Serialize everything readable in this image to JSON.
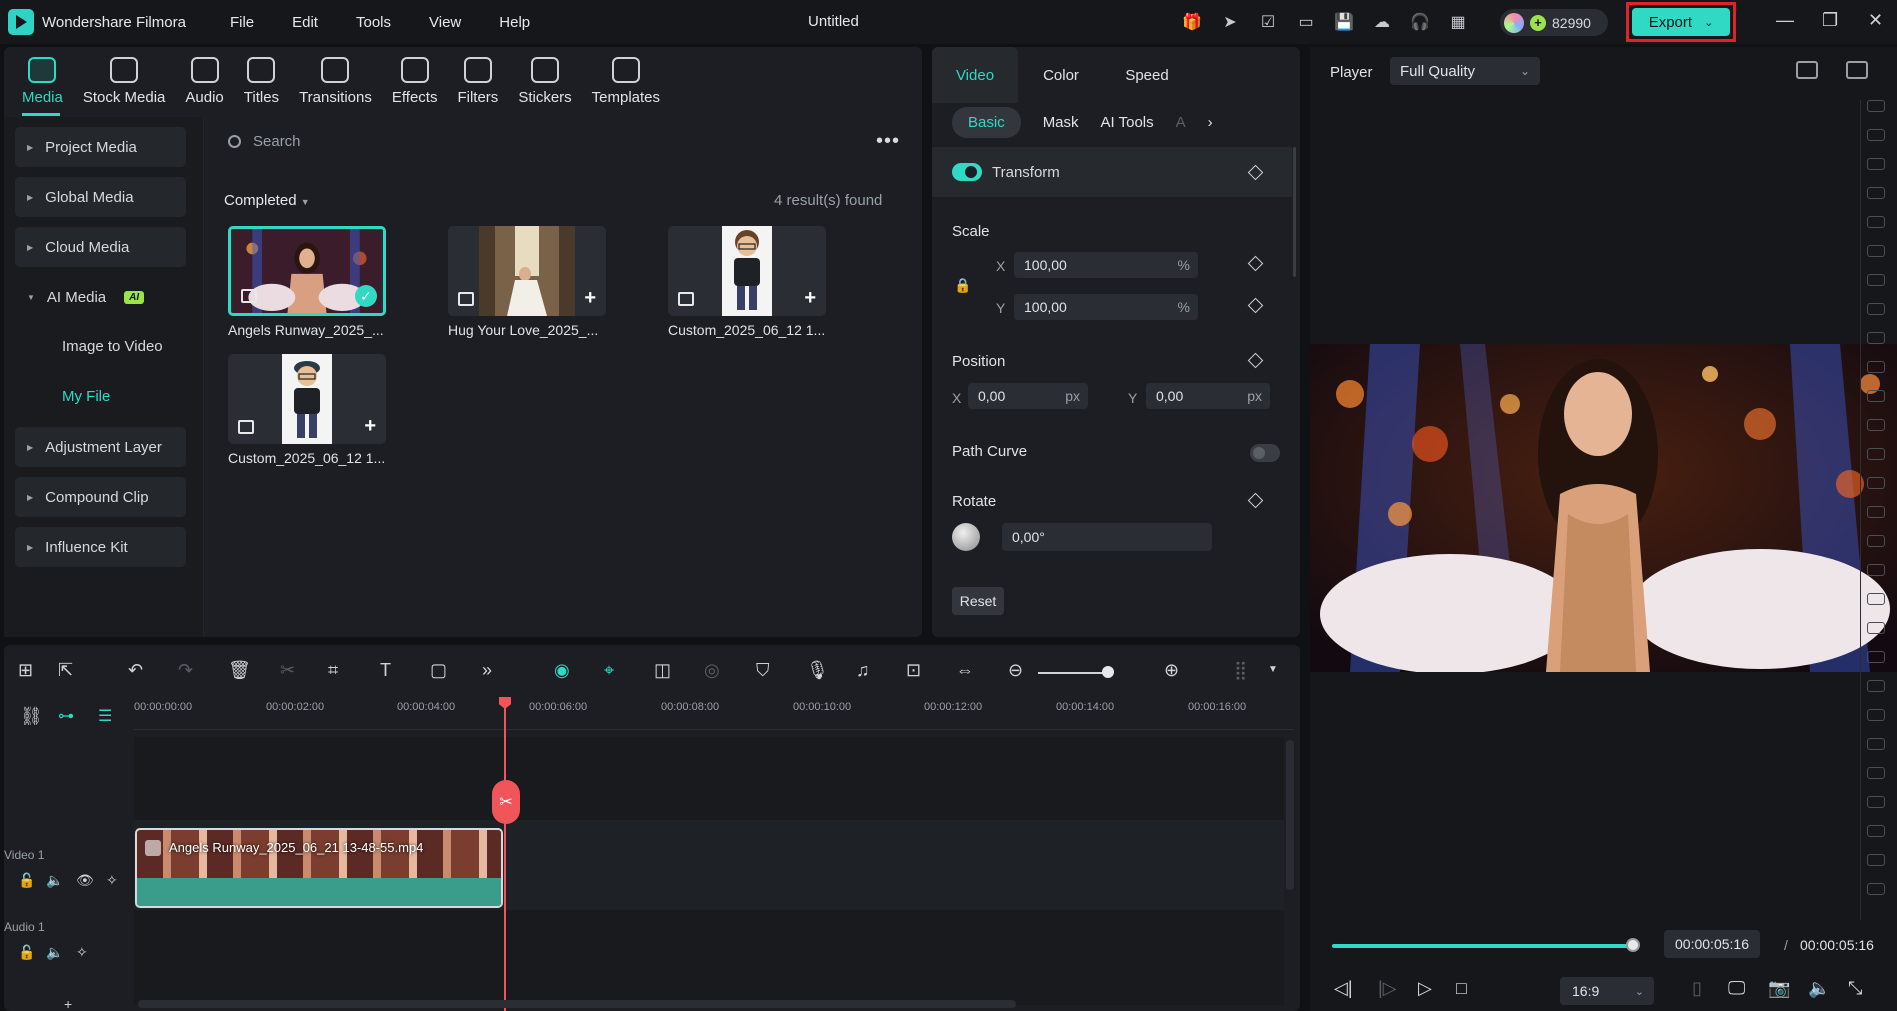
{
  "titlebar": {
    "app_name": "Wondershare Filmora",
    "menu": [
      "File",
      "Edit",
      "Tools",
      "View",
      "Help"
    ],
    "doc_title": "Untitled",
    "credits": "82990",
    "export_label": "Export"
  },
  "media_tabs": [
    "Media",
    "Stock Media",
    "Audio",
    "Titles",
    "Transitions",
    "Effects",
    "Filters",
    "Stickers",
    "Templates"
  ],
  "sidebar": {
    "items": [
      "Project Media",
      "Global Media",
      "Cloud Media",
      "AI Media",
      "Adjustment Layer",
      "Compound Clip",
      "Influence Kit"
    ],
    "ai_badge": "AI",
    "sub_items": [
      "Image to Video",
      "My File"
    ]
  },
  "library": {
    "search_placeholder": "Search",
    "filter_label": "Completed",
    "results": "4 result(s) found",
    "items": [
      {
        "label": "Angels Runway_2025_..."
      },
      {
        "label": "Hug Your Love_2025_..."
      },
      {
        "label": "Custom_2025_06_12 1..."
      },
      {
        "label": "Custom_2025_06_12 1..."
      }
    ]
  },
  "properties": {
    "tabs": [
      "Video",
      "Color",
      "Speed"
    ],
    "subtabs": [
      "Basic",
      "Mask",
      "AI Tools",
      "A"
    ],
    "transform_label": "Transform",
    "scale_label": "Scale",
    "scale_x": "100,00",
    "scale_y": "100,00",
    "percent": "%",
    "position_label": "Position",
    "pos_x": "0,00",
    "pos_y": "0,00",
    "px": "px",
    "path_curve_label": "Path Curve",
    "rotate_label": "Rotate",
    "rotate_value": "0,00°",
    "reset_label": "Reset",
    "x": "X",
    "y": "Y"
  },
  "player": {
    "label": "Player",
    "quality": "Full Quality",
    "current_time": "00:00:05:16",
    "separator": "/",
    "total_time": "00:00:05:16",
    "ratio": "16:9",
    "progress": 1.0
  },
  "timeline": {
    "ticks": [
      "00:00:00:00",
      "00:00:02:00",
      "00:00:04:00",
      "00:00:06:00",
      "00:00:08:00",
      "00:00:10:00",
      "00:00:12:00",
      "00:00:14:00",
      "00:00:16:00"
    ],
    "video_track": "Video 1",
    "audio_track": "Audio 1",
    "clip_name": "Angels Runway_2025_06_21 13-48-55.mp4"
  },
  "colors": {
    "accent": "#2fd9c4",
    "playhead": "#f0555a",
    "export_highlight": "#e0222a"
  }
}
